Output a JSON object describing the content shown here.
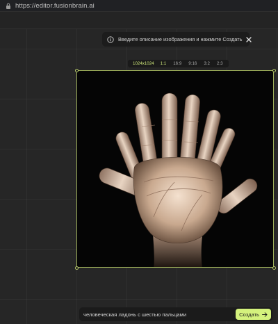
{
  "browser": {
    "url": "https://editor.fusionbrain.ai"
  },
  "toast": {
    "icon": "info-icon",
    "text": "Введите описание изображения и нажмите Создать",
    "close_icon": "close-icon"
  },
  "ratio_bar": {
    "size_label": "1024x1024",
    "options": [
      "1:1",
      "16:9",
      "9:16",
      "3:2",
      "2:3"
    ],
    "selected": "1:1"
  },
  "image": {
    "subject": "human palm with six fingers",
    "icon": "hand-image"
  },
  "prompt": {
    "value": "человеческая ладонь с шестью пальцами",
    "create_label": "Создать",
    "create_icon": "arrow-right-icon"
  },
  "colors": {
    "accent": "#d4f27d",
    "frame": "#9fb15a",
    "background": "#262626"
  }
}
